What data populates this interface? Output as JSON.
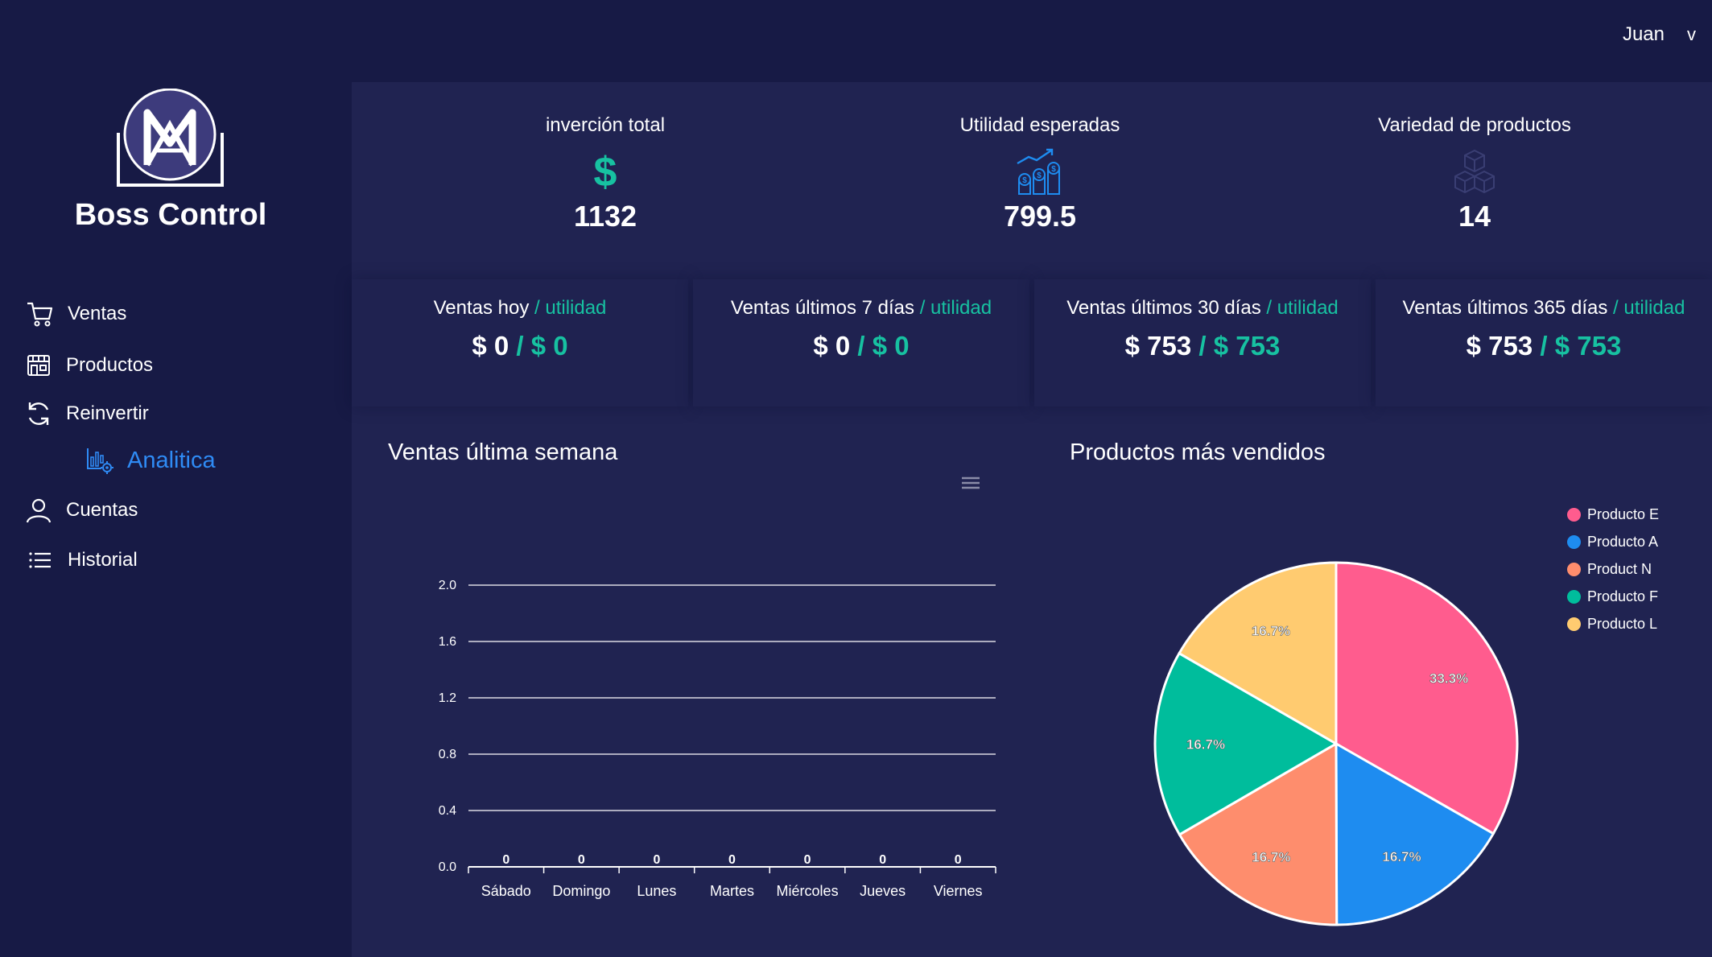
{
  "header": {
    "user_name": "Juan",
    "menu_chevron": "v"
  },
  "brand": {
    "name": "Boss Control",
    "logo_icon": "m-logo-icon"
  },
  "sidebar": {
    "items": [
      {
        "label": "Ventas",
        "icon": "cart-icon"
      },
      {
        "label": "Productos",
        "icon": "store-icon"
      },
      {
        "label": "Reinvertir",
        "icon": "refresh-icon"
      },
      {
        "label": "Analitica",
        "icon": "analytics-icon",
        "active": true
      },
      {
        "label": "Cuentas",
        "icon": "user-icon"
      },
      {
        "label": "Historial",
        "icon": "list-icon"
      }
    ]
  },
  "kpis": [
    {
      "label": "inverción total",
      "value": "1132",
      "icon": "dollar-icon"
    },
    {
      "label": "Utilidad esperadas",
      "value": "799.5",
      "icon": "coins-growth-icon"
    },
    {
      "label": "Variedad de productos",
      "value": "14",
      "icon": "cubes-icon"
    }
  ],
  "sales": [
    {
      "title": "Ventas hoy",
      "util_label": " / utilidad",
      "amount": "$ 0",
      "util_amount": " / $ 0"
    },
    {
      "title": "Ventas últimos 7 días",
      "util_label": " / utilidad",
      "amount": "$ 0",
      "util_amount": " / $ 0"
    },
    {
      "title": "Ventas últimos 30 días",
      "util_label": " / utilidad",
      "amount": "$ 753",
      "util_amount": " / $ 753"
    },
    {
      "title": "Ventas últimos 365 días",
      "util_label": " / utilidad",
      "amount": "$ 753",
      "util_amount": " / $ 753"
    }
  ],
  "colors": {
    "accent": "#17c1a1",
    "active_nav": "#2f8bf5",
    "background": "#171a45",
    "panel": "#202351"
  },
  "chart_data": [
    {
      "type": "bar",
      "title": "Ventas última semana",
      "categories": [
        "Sábado",
        "Domingo",
        "Lunes",
        "Martes",
        "Miércoles",
        "Jueves",
        "Viernes"
      ],
      "values": [
        0,
        0,
        0,
        0,
        0,
        0,
        0
      ],
      "data_labels": [
        "0",
        "0",
        "0",
        "0",
        "0",
        "0",
        "0"
      ],
      "yticks": [
        "0.0",
        "0.4",
        "0.8",
        "1.2",
        "1.6",
        "2.0"
      ],
      "ylim": [
        0,
        2
      ],
      "grid": true,
      "xlabel": "",
      "ylabel": "",
      "menu_icon": "hamburger-icon"
    },
    {
      "type": "pie",
      "title": "Productos más vendidos",
      "legend_position": "right",
      "slices": [
        {
          "name": "Producto E",
          "value": 33.3,
          "label": "33.3%",
          "color": "#ff5c8e"
        },
        {
          "name": "Producto A",
          "value": 16.7,
          "label": "16.7%",
          "color": "#1e8cf0"
        },
        {
          "name": "Product N",
          "value": 16.7,
          "label": "16.7%",
          "color": "#fe8d6d"
        },
        {
          "name": "Producto F",
          "value": 16.7,
          "label": "16.7%",
          "color": "#00bd9c"
        },
        {
          "name": "Producto L",
          "value": 16.7,
          "label": "16.7%",
          "color": "#ffcb70"
        }
      ]
    }
  ]
}
